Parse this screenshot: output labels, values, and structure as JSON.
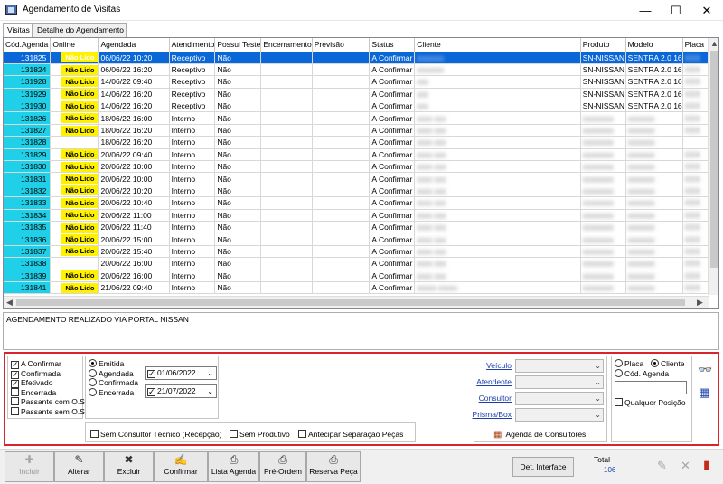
{
  "window": {
    "title": "Agendamento de Visitas",
    "minimize": "—",
    "maximize": "☐",
    "close": "✕"
  },
  "tabs": [
    "Visitas",
    "Detalhe do Agendamento"
  ],
  "grid": {
    "columns": [
      "Cód.Agenda",
      "Online",
      "Agendada",
      "Atendimento",
      "Possui Teste",
      "Encerramento",
      "Previsão",
      "Status",
      "Cliente",
      "Produto",
      "Modelo",
      "Placa"
    ],
    "rows": [
      {
        "code": "131825",
        "online": "Não Lido",
        "agendada": "06/06/22 10:20",
        "atendimento": "Receptivo",
        "teste": "Não",
        "status": "A Confirmar",
        "cliente": "xxxxxxx",
        "produto": "SN-NISSAN",
        "modelo": "SENTRA 2.0 16",
        "placa": "XXX",
        "selected": true
      },
      {
        "code": "131824",
        "online": "Não Lido",
        "agendada": "06/06/22 16:20",
        "atendimento": "Receptivo",
        "teste": "Não",
        "status": "A Confirmar",
        "cliente": "xxxxxxx",
        "produto": "SN-NISSAN",
        "modelo": "SENTRA 2.0 16",
        "placa": "XXX",
        "selected": false
      },
      {
        "code": "131928",
        "online": "Não Lido",
        "agendada": "14/06/22 09:40",
        "atendimento": "Receptivo",
        "teste": "Não",
        "status": "A Confirmar",
        "cliente": "xxx",
        "produto": "SN-NISSAN",
        "modelo": "SENTRA 2.0 16",
        "placa": "XXX",
        "selected": false
      },
      {
        "code": "131929",
        "online": "Não Lido",
        "agendada": "14/06/22 16:20",
        "atendimento": "Receptivo",
        "teste": "Não",
        "status": "A Confirmar",
        "cliente": "xxx",
        "produto": "SN-NISSAN",
        "modelo": "SENTRA 2.0 16",
        "placa": "XXX",
        "selected": false
      },
      {
        "code": "131930",
        "online": "Não Lido",
        "agendada": "14/06/22 16:20",
        "atendimento": "Receptivo",
        "teste": "Não",
        "status": "A Confirmar",
        "cliente": "xxx",
        "produto": "SN-NISSAN",
        "modelo": "SENTRA 2.0 16",
        "placa": "XXX",
        "selected": false
      },
      {
        "code": "131826",
        "online": "Não Lido",
        "agendada": "18/06/22 16:00",
        "atendimento": "Interno",
        "teste": "Não",
        "status": "A Confirmar",
        "cliente": "xxxx xxx",
        "produto": "xxxxxxxx",
        "modelo": "xxxxxxx",
        "placa": "XXX",
        "selected": false
      },
      {
        "code": "131827",
        "online": "Não Lido",
        "agendada": "18/06/22 16:20",
        "atendimento": "Interno",
        "teste": "Não",
        "status": "A Confirmar",
        "cliente": "xxxx xxx",
        "produto": "xxxxxxxx",
        "modelo": "xxxxxxx",
        "placa": "XXX",
        "selected": false
      },
      {
        "code": "131828",
        "online": "",
        "agendada": "18/06/22 16:20",
        "atendimento": "Interno",
        "teste": "Não",
        "status": "A Confirmar",
        "cliente": "xxxx xxx",
        "produto": "xxxxxxxx",
        "modelo": "xxxxxxx",
        "placa": "",
        "selected": false
      },
      {
        "code": "131829",
        "online": "Não Lido",
        "agendada": "20/06/22 09:40",
        "atendimento": "Interno",
        "teste": "Não",
        "status": "A Confirmar",
        "cliente": "xxxx xxx",
        "produto": "xxxxxxxx",
        "modelo": "xxxxxxx",
        "placa": "XXX",
        "selected": false
      },
      {
        "code": "131830",
        "online": "Não Lido",
        "agendada": "20/06/22 10:00",
        "atendimento": "Interno",
        "teste": "Não",
        "status": "A Confirmar",
        "cliente": "xxxx xxx",
        "produto": "xxxxxxxx",
        "modelo": "xxxxxxx",
        "placa": "XXX",
        "selected": false
      },
      {
        "code": "131831",
        "online": "Não Lido",
        "agendada": "20/06/22 10:00",
        "atendimento": "Interno",
        "teste": "Não",
        "status": "A Confirmar",
        "cliente": "xxxx xxx",
        "produto": "xxxxxxxx",
        "modelo": "xxxxxxx",
        "placa": "XXX",
        "selected": false
      },
      {
        "code": "131832",
        "online": "Não Lido",
        "agendada": "20/06/22 10:20",
        "atendimento": "Interno",
        "teste": "Não",
        "status": "A Confirmar",
        "cliente": "xxxx xxx",
        "produto": "xxxxxxxx",
        "modelo": "xxxxxxx",
        "placa": "XXX",
        "selected": false
      },
      {
        "code": "131833",
        "online": "Não Lido",
        "agendada": "20/06/22 10:40",
        "atendimento": "Interno",
        "teste": "Não",
        "status": "A Confirmar",
        "cliente": "xxxx xxx",
        "produto": "xxxxxxxx",
        "modelo": "xxxxxxx",
        "placa": "XXX",
        "selected": false
      },
      {
        "code": "131834",
        "online": "Não Lido",
        "agendada": "20/06/22 11:00",
        "atendimento": "Interno",
        "teste": "Não",
        "status": "A Confirmar",
        "cliente": "xxxx xxx",
        "produto": "xxxxxxxx",
        "modelo": "xxxxxxx",
        "placa": "XXX",
        "selected": false
      },
      {
        "code": "131835",
        "online": "Não Lido",
        "agendada": "20/06/22 11:40",
        "atendimento": "Interno",
        "teste": "Não",
        "status": "A Confirmar",
        "cliente": "xxxx xxx",
        "produto": "xxxxxxxx",
        "modelo": "xxxxxxx",
        "placa": "XXX",
        "selected": false
      },
      {
        "code": "131836",
        "online": "Não Lido",
        "agendada": "20/06/22 15:00",
        "atendimento": "Interno",
        "teste": "Não",
        "status": "A Confirmar",
        "cliente": "xxxx xxx",
        "produto": "xxxxxxxx",
        "modelo": "xxxxxxx",
        "placa": "XXX",
        "selected": false
      },
      {
        "code": "131837",
        "online": "Não Lido",
        "agendada": "20/06/22 15:40",
        "atendimento": "Interno",
        "teste": "Não",
        "status": "A Confirmar",
        "cliente": "xxxx xxx",
        "produto": "xxxxxxxx",
        "modelo": "xxxxxxx",
        "placa": "XXX",
        "selected": false
      },
      {
        "code": "131838",
        "online": "",
        "agendada": "20/06/22 16:00",
        "atendimento": "Interno",
        "teste": "Não",
        "status": "A Confirmar",
        "cliente": "xxxx xxx",
        "produto": "xxxxxxxx",
        "modelo": "xxxxxxx",
        "placa": "XXX",
        "selected": false
      },
      {
        "code": "131839",
        "online": "Não Lido",
        "agendada": "20/06/22 16:00",
        "atendimento": "Interno",
        "teste": "Não",
        "status": "A Confirmar",
        "cliente": "xxxx xxx",
        "produto": "xxxxxxxx",
        "modelo": "xxxxxxx",
        "placa": "XXX",
        "selected": false
      },
      {
        "code": "131841",
        "online": "Não Lido",
        "agendada": "21/06/22 09:40",
        "atendimento": "Interno",
        "teste": "Não",
        "status": "A Confirmar",
        "cliente": "xxxxx xxxxx",
        "produto": "xxxxxxxx",
        "modelo": "xxxxxxx",
        "placa": "XXX",
        "selected": false
      }
    ]
  },
  "observation": "AGENDAMENTO REALIZADO VIA PORTAL NISSAN",
  "filters": {
    "status_checks": [
      {
        "label": "A Confirmar",
        "checked": true
      },
      {
        "label": "Confirmada",
        "checked": true
      },
      {
        "label": "Efetivado",
        "checked": true
      },
      {
        "label": "Encerrada",
        "checked": false
      },
      {
        "label": "Passante com O.S",
        "checked": false
      },
      {
        "label": "Passante sem O.S",
        "checked": false
      }
    ],
    "date_type": [
      {
        "label": "Emitida",
        "selected": true
      },
      {
        "label": "Agendada",
        "selected": false
      },
      {
        "label": "Confirmada",
        "selected": false
      },
      {
        "label": "Encerrada",
        "selected": false
      }
    ],
    "date_from": "01/06/2022",
    "date_to": "21/07/2022",
    "options": [
      {
        "label": "Sem Consultor Técnico (Recepção)",
        "checked": false
      },
      {
        "label": "Sem Produtivo",
        "checked": false
      },
      {
        "label": "Antecipar Separação Peças",
        "checked": false
      }
    ],
    "combo_labels": [
      "Veículo",
      "Atendente",
      "Consultor",
      "Prisma/Box"
    ],
    "agenda_consultores": "Agenda de Consultores",
    "search_by": [
      {
        "label": "Placa",
        "selected": false
      },
      {
        "label": "Cliente",
        "selected": true
      },
      {
        "label": "Cód. Agenda",
        "selected": false
      }
    ],
    "qualquer_posicao": "Qualquer Posição"
  },
  "toolbar": {
    "buttons": [
      {
        "label": "Incluir",
        "icon": "✚",
        "disabled": true
      },
      {
        "label": "Alterar",
        "icon": "✎",
        "disabled": false
      },
      {
        "label": "Excluir",
        "icon": "✖",
        "disabled": false
      },
      {
        "label": "Confirmar",
        "icon": "✍",
        "disabled": false
      },
      {
        "label": "Lista Agenda",
        "icon": "⎙",
        "disabled": false
      },
      {
        "label": "Pré-Ordem",
        "icon": "⎙",
        "disabled": false
      },
      {
        "label": "Reserva Peça",
        "icon": "⎙",
        "disabled": false
      }
    ],
    "det_interface": "Det. Interface",
    "total_label": "Total",
    "total_value": "106"
  }
}
